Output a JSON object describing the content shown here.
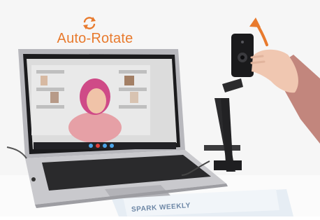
{
  "caption": {
    "text": "Auto-Rotate"
  },
  "newspaper": {
    "headline": "SPARK WEEKLY"
  },
  "icons": {
    "rotate": "rotate-arrows-icon",
    "direction": "curved-arrow-up-icon"
  },
  "colors": {
    "accent": "#e87a2d",
    "background": "#ffffff"
  }
}
